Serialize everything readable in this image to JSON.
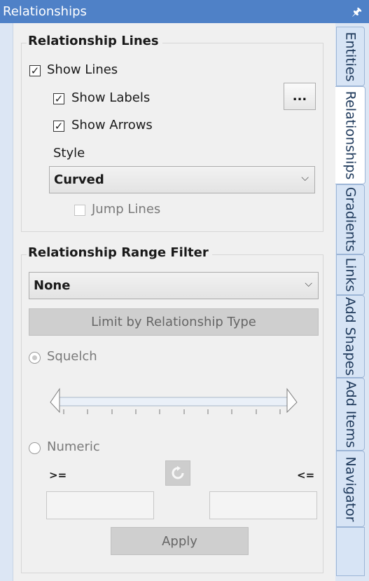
{
  "panel_title": "Relationships",
  "pin_glyph": "ᅮ",
  "relationship_lines": {
    "title": "Relationship Lines",
    "show_lines": {
      "label": "Show Lines",
      "checked": true
    },
    "show_labels": {
      "label": "Show Labels",
      "checked": true
    },
    "ellipsis_label": "...",
    "show_arrows": {
      "label": "Show Arrows",
      "checked": true
    },
    "style_label": "Style",
    "style_value": "Curved",
    "jump_lines": {
      "label": "Jump Lines",
      "checked": false,
      "enabled": false
    }
  },
  "range_filter": {
    "title": "Relationship Range Filter",
    "filter_value": "None",
    "limit_button": "Limit by Relationship Type",
    "squelch_label": "Squelch",
    "numeric_label": "Numeric",
    "gte_label": ">=",
    "lte_label": "<=",
    "reset_icon": "refresh-icon",
    "min_value": "",
    "max_value": "",
    "apply_label": "Apply"
  },
  "tabs": [
    {
      "label": "Entities",
      "active": false
    },
    {
      "label": "Relationships",
      "active": true
    },
    {
      "label": "Gradients",
      "active": false
    },
    {
      "label": "Links",
      "active": false
    },
    {
      "label": "Add Shapes",
      "active": false
    },
    {
      "label": "Add Items",
      "active": false
    },
    {
      "label": "Navigator",
      "active": false
    }
  ],
  "check_glyph": "✓",
  "dropdown_glyph": "⌵"
}
